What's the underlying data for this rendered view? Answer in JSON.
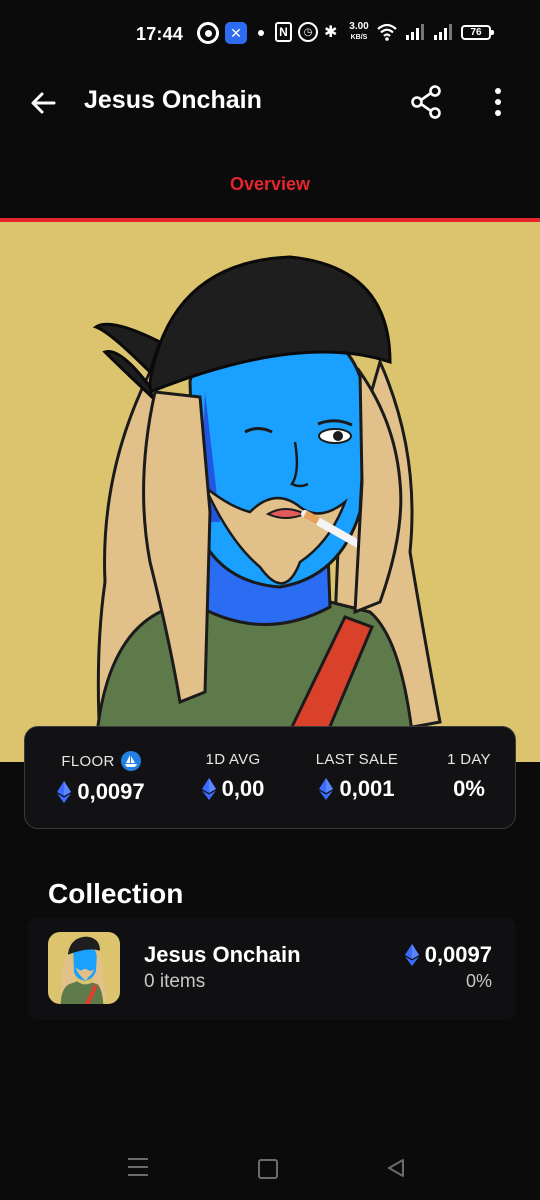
{
  "status_bar": {
    "time": "17:44",
    "app_badge": "✕",
    "nfc": "N",
    "speed_value": "3.00",
    "speed_unit": "KB/S",
    "battery": "76"
  },
  "app_bar": {
    "title": "Jesus Onchain",
    "back_icon": "arrow-left-icon",
    "share_icon": "share-icon",
    "more_icon": "more-vertical-icon"
  },
  "tabs": [
    {
      "label": "Overview",
      "active": true
    }
  ],
  "colors": {
    "accent": "#e4262c",
    "hero_bg": "#dcc46f",
    "eth_blue": "#3b6cff",
    "opensea_blue": "#2081e2",
    "card_bg": "#121214"
  },
  "stats": {
    "floor": {
      "label": "FLOOR",
      "value": "0,0097"
    },
    "day_avg": {
      "label": "1D AVG",
      "value": "0,00"
    },
    "last_sale": {
      "label": "LAST SALE",
      "value": "0,001"
    },
    "one_day": {
      "label": "1 DAY",
      "value": "0%"
    }
  },
  "collection": {
    "heading": "Collection",
    "item": {
      "name": "Jesus Onchain",
      "items": "0 items",
      "price": "0,0097",
      "change": "0%"
    }
  }
}
